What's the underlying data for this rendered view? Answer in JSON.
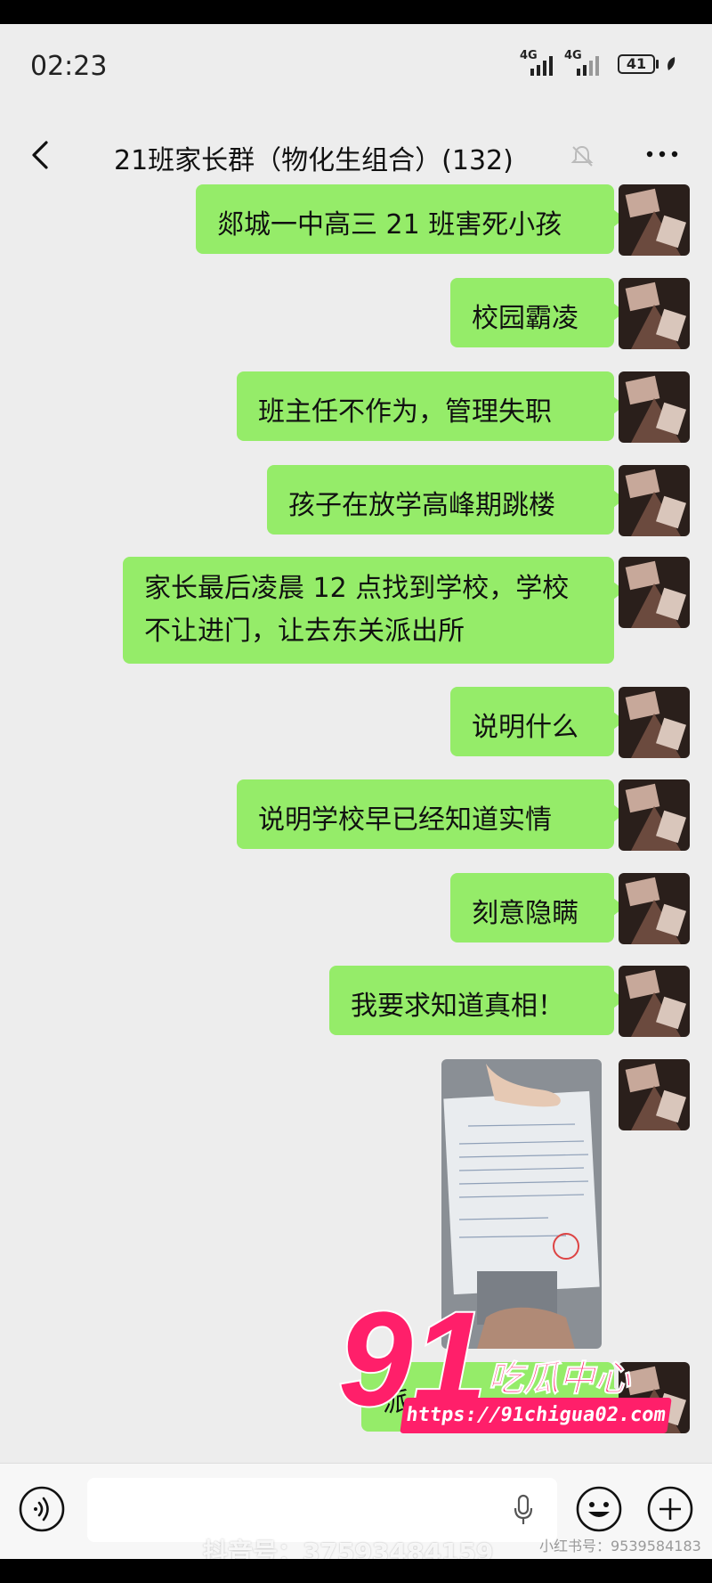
{
  "status_bar": {
    "time": "02:23",
    "network_1": "4G",
    "network_2": "4G",
    "battery": "41"
  },
  "header": {
    "title": "21班家长群（物化生组合）(132)"
  },
  "messages": [
    {
      "text": "郯城一中高三 21 班害死小孩"
    },
    {
      "text": "校园霸凌"
    },
    {
      "text": "班主任不作为，管理失职"
    },
    {
      "text": "孩子在放学高峰期跳楼"
    },
    {
      "text": "家长最后凌晨 12 点找到学校，学校不让进门，让去东关派出所"
    },
    {
      "text": "说明什么"
    },
    {
      "text": "说明学校早已经知道实情"
    },
    {
      "text": "刻意隐瞒"
    },
    {
      "text": "我要求知道真相！"
    },
    {
      "text": "派"
    }
  ],
  "watermark": {
    "number": "91",
    "brand": "吃瓜中心",
    "url": "https://91chigua02.com"
  },
  "input_bar": {
    "douyin_id": "抖音号：37593484159",
    "corner_text": "小红书号：9539584183"
  },
  "colors": {
    "bubble": "#95ec69",
    "background": "#ededed",
    "watermark": "#ff1f6a"
  }
}
